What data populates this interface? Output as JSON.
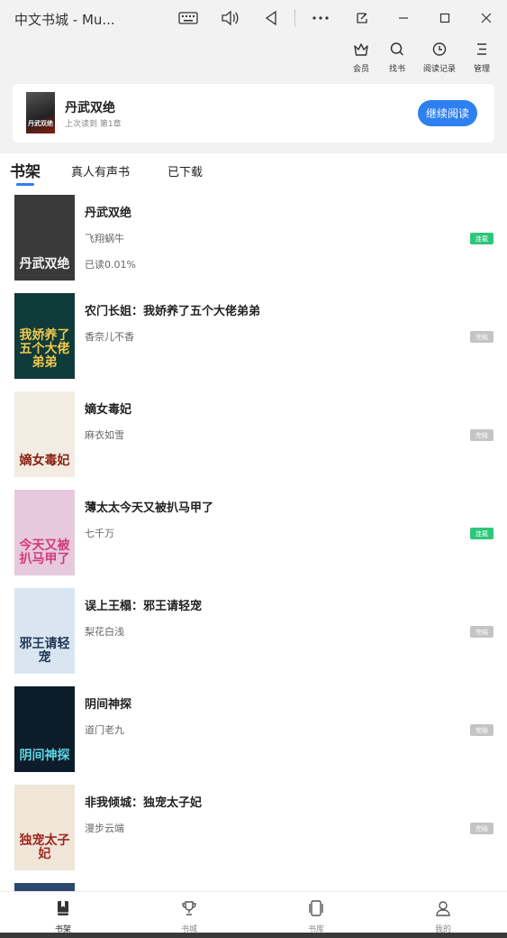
{
  "window": {
    "title": "中文书城 - Mu..."
  },
  "toolbar": {
    "items": [
      {
        "label": "会员",
        "icon": "crown-icon"
      },
      {
        "label": "找书",
        "icon": "search-icon"
      },
      {
        "label": "阅读记录",
        "icon": "clock-icon"
      },
      {
        "label": "管理",
        "icon": "manage-icon"
      }
    ]
  },
  "recent": {
    "title": "丹武双绝",
    "subtitle": "上次读到 第1章",
    "continue_label": "继续阅读"
  },
  "tabs": [
    {
      "label": "书架"
    },
    {
      "label": "真人有声书"
    },
    {
      "label": "已下载"
    }
  ],
  "books": [
    {
      "title": "丹武双绝",
      "author": "飞翔蜗牛",
      "progress": "已读0.01%",
      "status": "连载",
      "status_type": "serial",
      "cover_text": "丹武双绝",
      "cover_bg": "#3a3a3a",
      "cover_fg": "#f3f3f3"
    },
    {
      "title": "农门长姐：我娇养了五个大佬弟弟",
      "author": "香奈儿不香",
      "progress": "",
      "status": "完结",
      "status_type": "done",
      "cover_text": "我娇养了五个大佬弟弟",
      "cover_bg": "#0f3b3a",
      "cover_fg": "#f0c84a"
    },
    {
      "title": "嫡女毒妃",
      "author": "麻衣如雪",
      "progress": "",
      "status": "完结",
      "status_type": "done",
      "cover_text": "嫡女毒妃",
      "cover_bg": "#f3ece2",
      "cover_fg": "#8a1f14"
    },
    {
      "title": "薄太太今天又被扒马甲了",
      "author": "七千万",
      "progress": "",
      "status": "连载",
      "status_type": "serial",
      "cover_text": "今天又被扒马甲了",
      "cover_bg": "#e7c9de",
      "cover_fg": "#d23a7a"
    },
    {
      "title": "误上王榻：邪王请轻宠",
      "author": "梨花白浅",
      "progress": "",
      "status": "完结",
      "status_type": "done",
      "cover_text": "邪王请轻宠",
      "cover_bg": "#d9e6f2",
      "cover_fg": "#1f3552"
    },
    {
      "title": "阴间神探",
      "author": "道门老九",
      "progress": "",
      "status": "完结",
      "status_type": "done",
      "cover_text": "阴间神探",
      "cover_bg": "#0c1c28",
      "cover_fg": "#5fd6e6"
    },
    {
      "title": "非我倾城：独宠太子妃",
      "author": "漫步云端",
      "progress": "",
      "status": "完结",
      "status_type": "done",
      "cover_text": "独宠太子妃",
      "cover_bg": "#efe6d8",
      "cover_fg": "#a0271d"
    }
  ],
  "bottom_nav": [
    {
      "label": "书架",
      "icon": "bookshelf-icon",
      "active": true
    },
    {
      "label": "书城",
      "icon": "trophy-icon",
      "active": false
    },
    {
      "label": "书库",
      "icon": "library-icon",
      "active": false
    },
    {
      "label": "我的",
      "icon": "user-icon",
      "active": false
    }
  ],
  "colors": {
    "accent": "#2e7ff0",
    "serial_badge": "#2ec77a",
    "done_badge": "#c4c4c4"
  }
}
